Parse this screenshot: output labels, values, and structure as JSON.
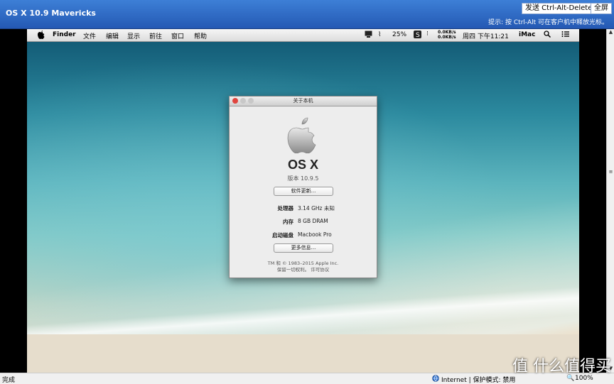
{
  "topbar": {
    "title": "OS X 10.9 Mavericks",
    "ctrl_alt_del": "发送 Ctrl-Alt-Delete",
    "fullscreen": "全屏",
    "hint": "提示: 按 Ctrl-Alt 可在客户机中释放光标。"
  },
  "menubar": {
    "items": [
      "Finder",
      "文件",
      "编辑",
      "显示",
      "前往",
      "窗口",
      "帮助"
    ],
    "battery": "25%",
    "net_up": "0.0KB/s",
    "net_down": "0.0KB/s",
    "clock": "周四 下午11:21",
    "computer": "iMac"
  },
  "dialog": {
    "title": "关于本机",
    "os_name": "OS X",
    "version": "版本 10.9.5",
    "update_button": "软件更新...",
    "processor_label": "处理器",
    "processor_value": "3.14 GHz 未知",
    "memory_label": "内存",
    "memory_value": "8 GB DRAM",
    "startup_label": "启动磁盘",
    "startup_value": "Macbook Pro",
    "more_button": "更多信息...",
    "copyright": "TM 和 © 1983–2015 Apple Inc.",
    "rights": "保留一切权利。  许可协议"
  },
  "statusbar": {
    "left": "完成",
    "zone": "Internet | 保护模式: 禁用",
    "zoom": "100%"
  },
  "watermark": "值 什么值得买"
}
